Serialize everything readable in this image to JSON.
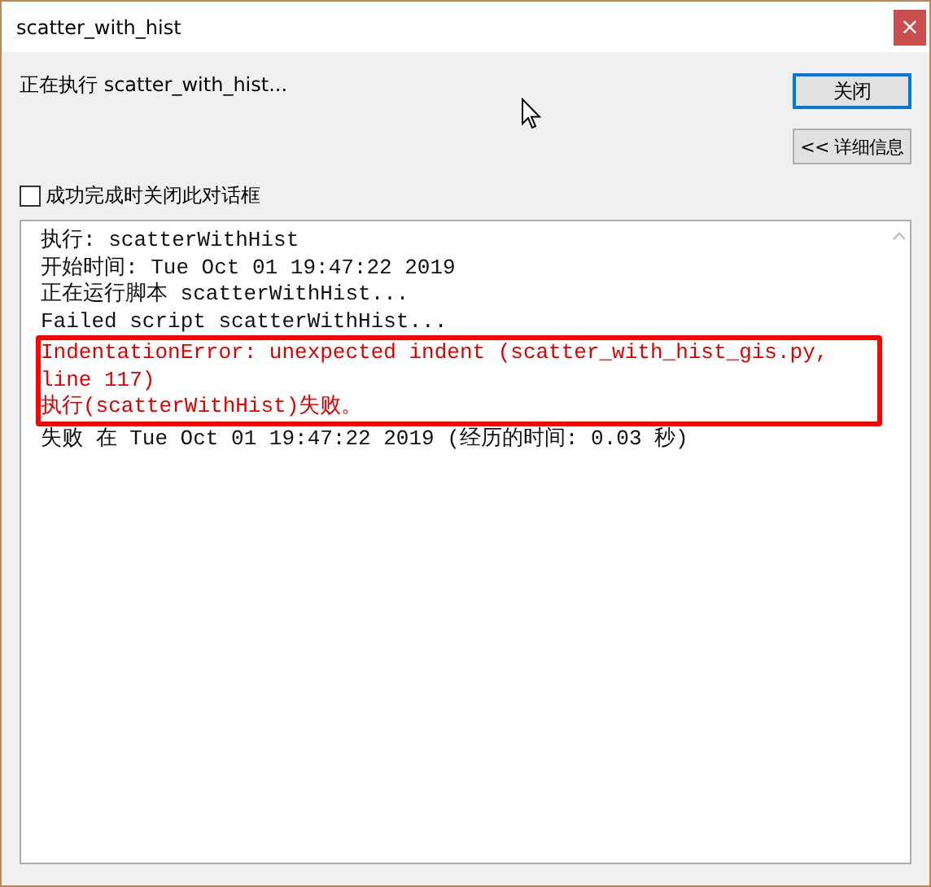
{
  "window": {
    "title": "scatter_with_hist",
    "close_glyph": "×"
  },
  "status": "正在执行 scatter_with_hist...",
  "buttons": [
    {
      "label": "关闭",
      "default": true
    },
    {
      "label": "<< 详细信息",
      "default": false
    }
  ],
  "close_on_success": {
    "label": "成功完成时关闭此对话框",
    "checked": false
  },
  "log": [
    {
      "text": "执行: scatterWithHist",
      "kind": "info"
    },
    {
      "text": "开始时间: Tue Oct 01 19:47:22 2019",
      "kind": "info"
    },
    {
      "text": "正在运行脚本 scatterWithHist...",
      "kind": "info"
    },
    {
      "text": "Failed script scatterWithHist...",
      "kind": "info"
    },
    {
      "text": "IndentationError: unexpected indent (scatter_with_hist_gis.py, line 117)",
      "kind": "error"
    },
    {
      "text": "执行(scatterWithHist)失败。",
      "kind": "error"
    },
    {
      "text": "失败 在 Tue Oct 01 19:47:22 2019 (经历的时间: 0.03 秒)",
      "kind": "info"
    }
  ]
}
